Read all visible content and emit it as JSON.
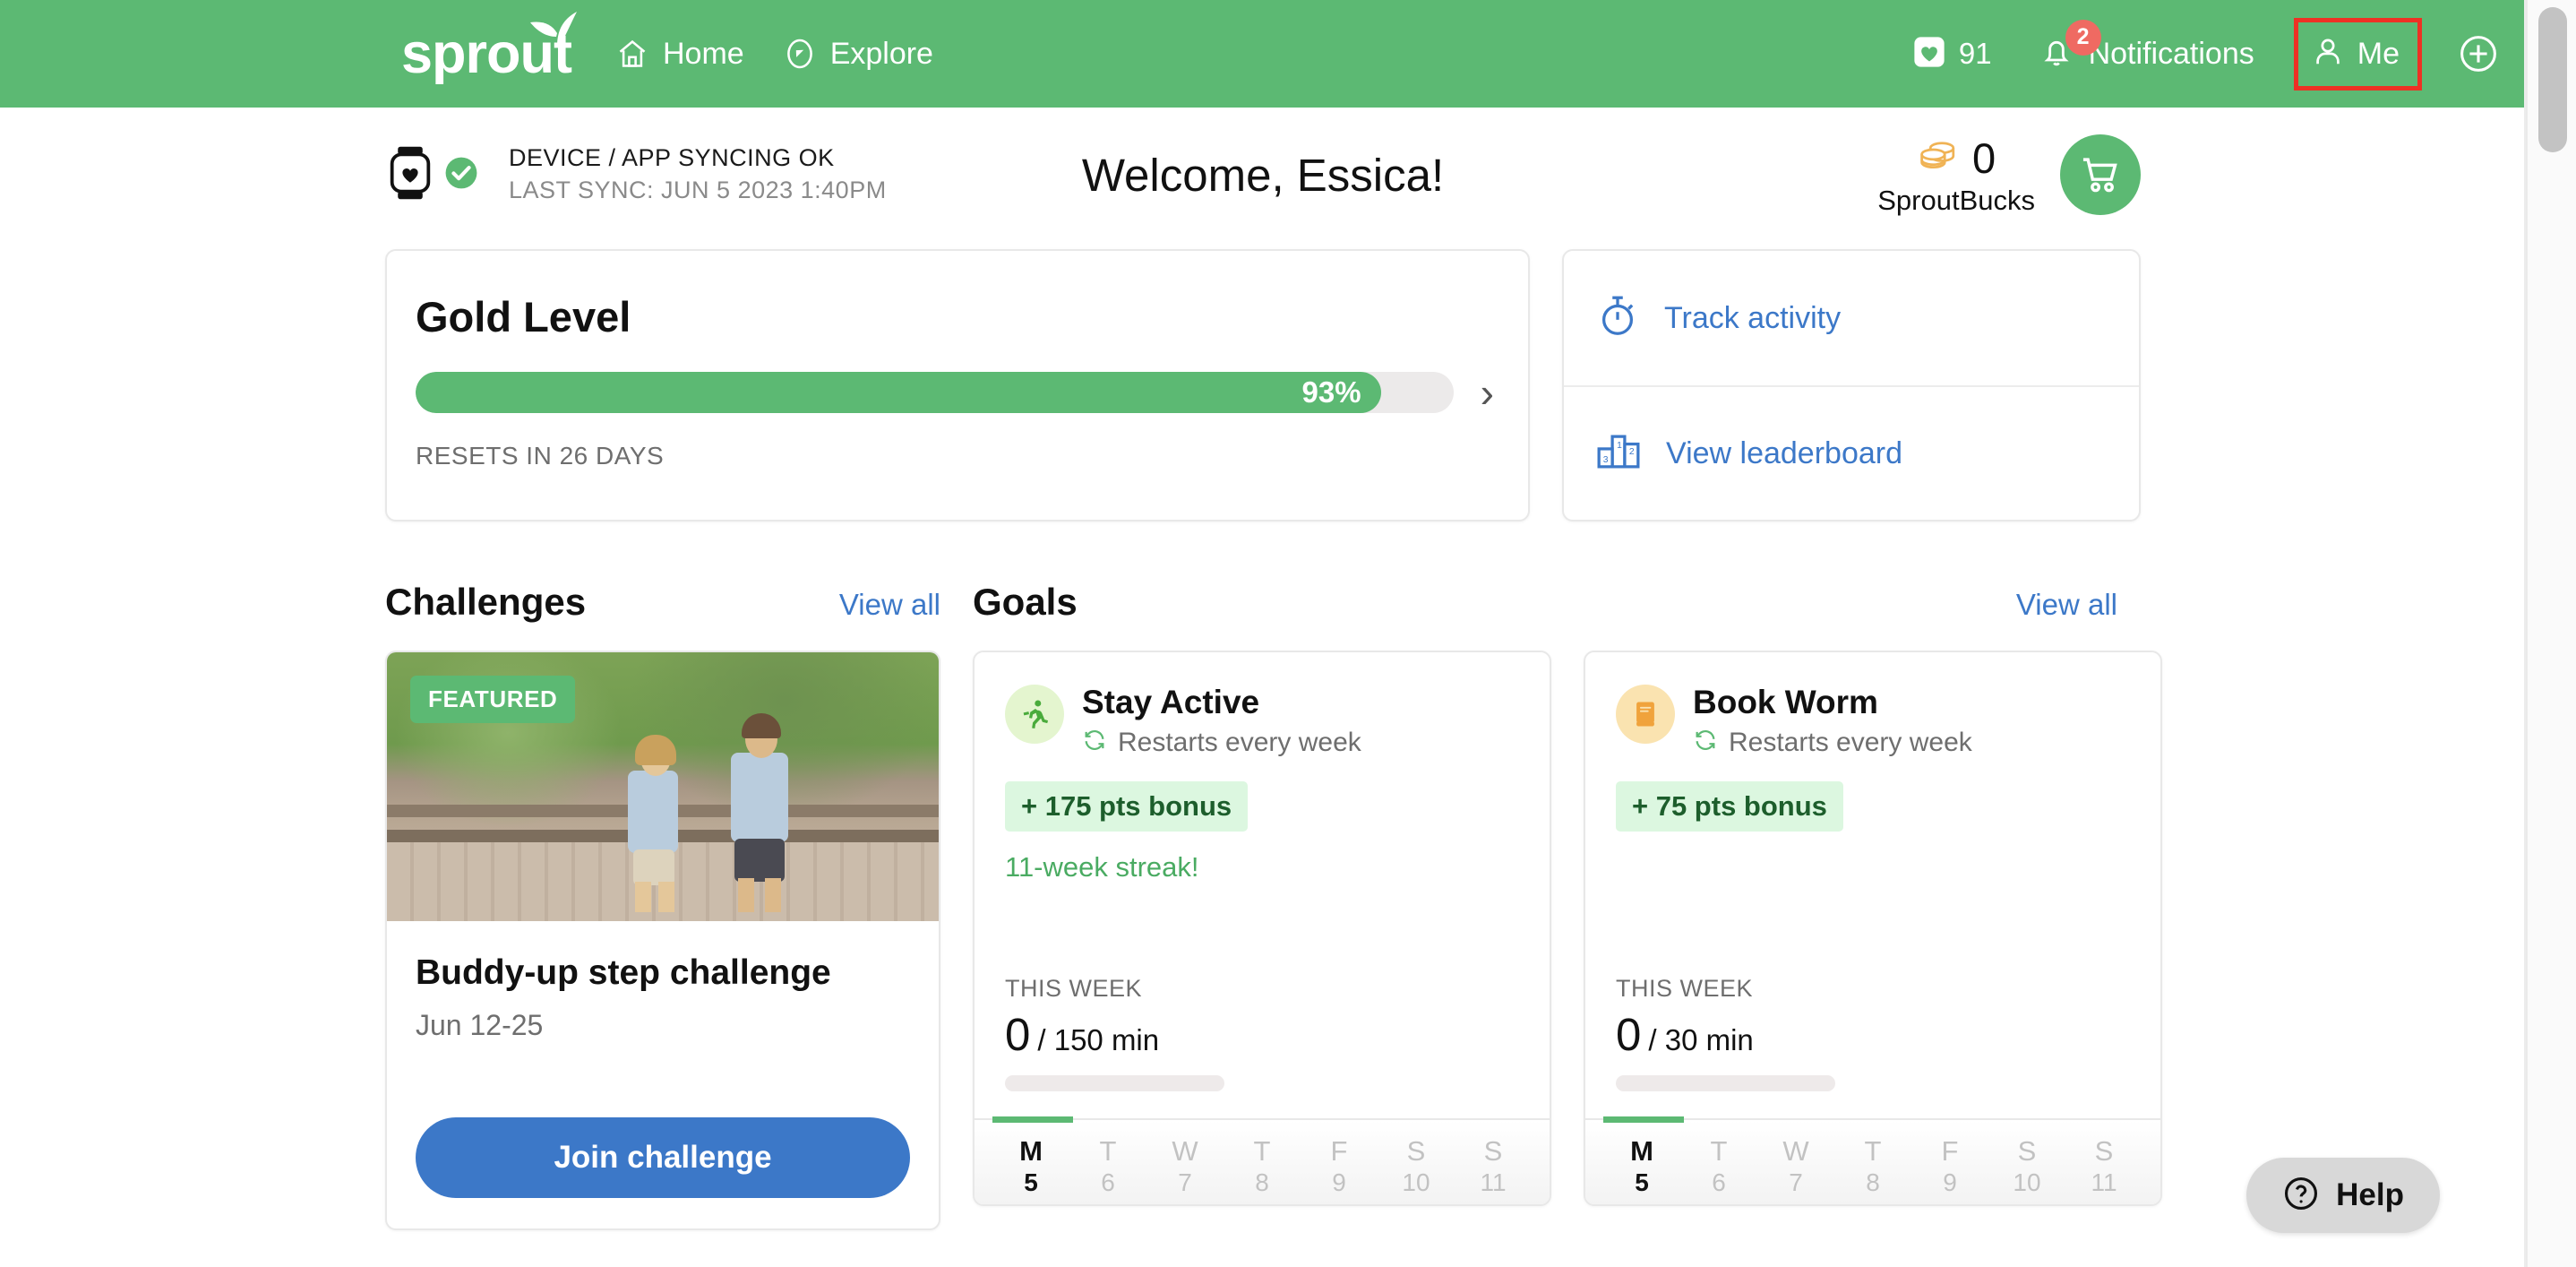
{
  "nav": {
    "logo_text": "sprout",
    "home_label": "Home",
    "explore_label": "Explore",
    "hearts_count": "91",
    "notifications_label": "Notifications",
    "notifications_badge": "2",
    "me_label": "Me",
    "icons": {
      "home": "home-icon",
      "explore": "compass-icon",
      "hearts": "heart-icon",
      "notifications": "bell-icon",
      "me": "person-icon",
      "add": "plus-circle-icon"
    },
    "colors": {
      "bar": "#5cb973",
      "badge": "#ef6a62",
      "highlight_outline": "#ee3124"
    }
  },
  "status": {
    "sync_line1": "DEVICE / APP SYNCING OK",
    "sync_line2": "LAST SYNC: JUN 5 2023 1:40PM",
    "watch_icon": "smartwatch-heart-icon",
    "check_icon": "check-circle-icon"
  },
  "welcome": {
    "title": "Welcome, Essica!"
  },
  "sproutbucks": {
    "amount": "0",
    "label": "SproutBucks",
    "coins_icon": "coin-stack-icon",
    "cart_icon": "shopping-cart-icon"
  },
  "gold_card": {
    "title": "Gold Level",
    "progress_label": "93%",
    "progress_percent": 93,
    "resets_text": "RESETS IN 26 DAYS",
    "chevron_icon": "chevron-right-icon"
  },
  "actions": {
    "items": [
      {
        "label": "Track activity",
        "icon": "stopwatch-icon"
      },
      {
        "label": "View leaderboard",
        "icon": "podium-icon"
      }
    ],
    "link_color": "#3c78c8"
  },
  "challenges": {
    "section_title": "Challenges",
    "view_all": "View all",
    "card": {
      "featured_badge": "FEATURED",
      "title": "Buddy-up step challenge",
      "date": "Jun 12-25",
      "button_label": "Join challenge",
      "photo_alt": "two hikers walking on a wooden bridge"
    }
  },
  "goals": {
    "section_title": "Goals",
    "view_all": "View all",
    "items": [
      {
        "name": "Stay Active",
        "restart_text": "Restarts every week",
        "restart_icon": "refresh-icon",
        "bonus": "+ 175 pts bonus",
        "streak": "11-week streak!",
        "this_week_label": "THIS WEEK",
        "current": "0",
        "target": "/ 150 min",
        "progress_percent": 0,
        "icon": "running-person-icon",
        "icon_bg": "#e4f5cf",
        "days": [
          {
            "d": "M",
            "n": "5",
            "active": true
          },
          {
            "d": "T",
            "n": "6",
            "active": false
          },
          {
            "d": "W",
            "n": "7",
            "active": false
          },
          {
            "d": "T",
            "n": "8",
            "active": false
          },
          {
            "d": "F",
            "n": "9",
            "active": false
          },
          {
            "d": "S",
            "n": "10",
            "active": false
          },
          {
            "d": "S",
            "n": "11",
            "active": false
          }
        ]
      },
      {
        "name": "Book Worm",
        "restart_text": "Restarts every week",
        "restart_icon": "refresh-icon",
        "bonus": "+ 75 pts bonus",
        "streak": "",
        "this_week_label": "THIS WEEK",
        "current": "0",
        "target": "/ 30 min",
        "progress_percent": 0,
        "icon": "book-icon",
        "icon_bg": "#fae3b0",
        "days": [
          {
            "d": "M",
            "n": "5",
            "active": true
          },
          {
            "d": "T",
            "n": "6",
            "active": false
          },
          {
            "d": "W",
            "n": "7",
            "active": false
          },
          {
            "d": "T",
            "n": "8",
            "active": false
          },
          {
            "d": "F",
            "n": "9",
            "active": false
          },
          {
            "d": "S",
            "n": "10",
            "active": false
          },
          {
            "d": "S",
            "n": "11",
            "active": false
          }
        ]
      }
    ]
  },
  "help": {
    "label": "Help",
    "icon": "question-circle-icon"
  }
}
